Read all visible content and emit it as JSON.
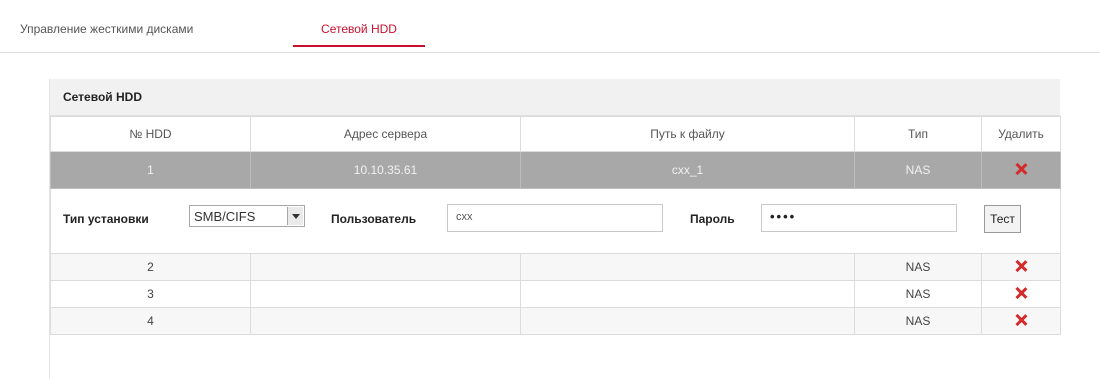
{
  "tabs": {
    "hdd_management": "Управление жесткими дисками",
    "net_hdd": "Сетевой HDD"
  },
  "panel": {
    "title": "Сетевой HDD",
    "columns": {
      "number": "№ HDD",
      "server": "Адрес сервера",
      "path": "Путь к файлу",
      "type": "Тип",
      "delete": "Удалить"
    },
    "selected_row": {
      "number": "1",
      "server": "10.10.35.61",
      "path": "cxx_1",
      "type": "NAS"
    },
    "detail": {
      "mount_type_label": "Тип установки",
      "mount_type_value": "SMB/CIFS",
      "user_label": "Пользователь",
      "user_value": "cxx",
      "password_label": "Пароль",
      "password_value": "••••",
      "test_button": "Тест"
    },
    "rows": [
      {
        "number": "2",
        "server": "",
        "path": "",
        "type": "NAS"
      },
      {
        "number": "3",
        "server": "",
        "path": "",
        "type": "NAS"
      },
      {
        "number": "4",
        "server": "",
        "path": "",
        "type": "NAS"
      }
    ]
  },
  "colors": {
    "accent": "#c8102e",
    "delete_icon": "#d42a2a",
    "selected_row": "#a8a8a8"
  },
  "icons": {
    "delete": "close-x-icon",
    "select_arrow": "chevron-down-icon"
  }
}
